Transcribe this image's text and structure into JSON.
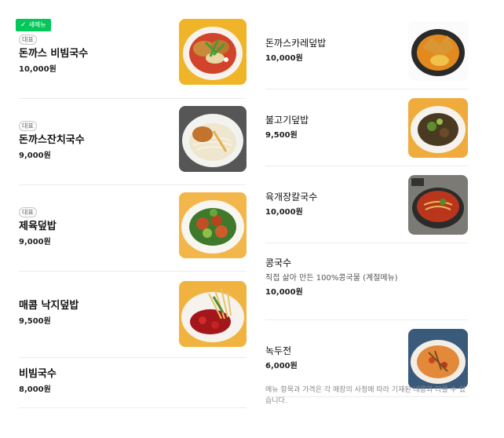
{
  "new_badge": {
    "check": "✓",
    "label": "새메뉴"
  },
  "left_items": [
    {
      "tag": "대표",
      "name": "돈까스 비빔국수",
      "price": "10,000원",
      "image": "tonkatsu-bibim-noodle"
    },
    {
      "tag": "대표",
      "name": "돈까스잔치국수",
      "price": "9,000원",
      "image": "tonkatsu-janchi-noodle"
    },
    {
      "tag": "대표",
      "name": "제육덮밥",
      "price": "9,000원",
      "image": "jeyuk-rice-bowl"
    },
    {
      "tag": "",
      "name": "매콤 낙지덮밥",
      "price": "9,500원",
      "image": "spicy-octopus-rice-bowl"
    },
    {
      "tag": "",
      "name": "비빔국수",
      "price": "8,000원",
      "image": ""
    }
  ],
  "right_items": [
    {
      "name": "돈까스카레덮밥",
      "desc": "",
      "price": "10,000원",
      "image": "tonkatsu-curry-rice"
    },
    {
      "name": "불고기덮밥",
      "desc": "",
      "price": "9,500원",
      "image": "bulgogi-rice-bowl"
    },
    {
      "name": "육개장칼국수",
      "desc": "",
      "price": "10,000원",
      "image": "yukgaejang-kalguksu"
    },
    {
      "name": "콩국수",
      "desc": "직접 삶아 만든 100%콩국물 (계절메뉴)",
      "price": "10,000원",
      "image": ""
    },
    {
      "name": "녹두전",
      "desc": "",
      "price": "6,000원",
      "image": "mungbean-pancake"
    }
  ],
  "notice": "메뉴 항목과 가격은 각 매장의 사정에 따라 기재된 내용과 다를 수 있습니다."
}
